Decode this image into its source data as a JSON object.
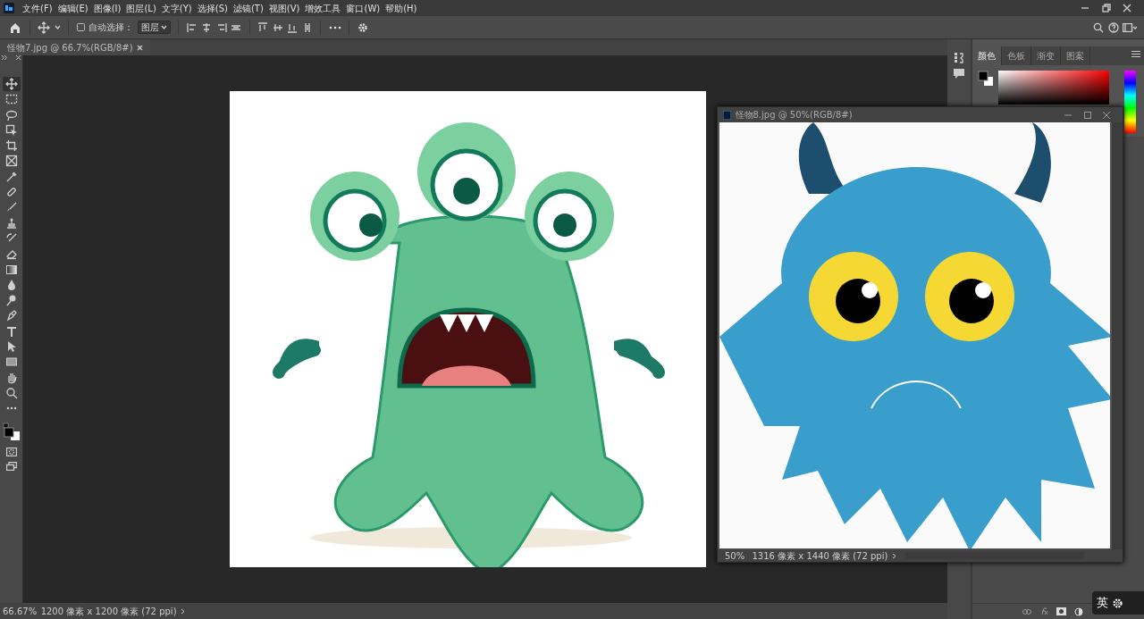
{
  "menu": [
    {
      "label": "文件(F)"
    },
    {
      "label": "编辑(E)"
    },
    {
      "label": "图像(I)"
    },
    {
      "label": "图层(L)"
    },
    {
      "label": "文字(Y)"
    },
    {
      "label": "选择(S)"
    },
    {
      "label": "滤镜(T)"
    },
    {
      "label": "视图(V)"
    },
    {
      "label": "增效工具"
    },
    {
      "label": "窗口(W)"
    },
    {
      "label": "帮助(H)"
    }
  ],
  "options_bar": {
    "auto_select": {
      "label": "自动选择：",
      "checked": false
    },
    "target": {
      "value": "图层"
    }
  },
  "document_tab": {
    "title": "怪物7.jpg @ 66.7%(RGB/8#)"
  },
  "tools": [
    {
      "kind": "move",
      "selected": true
    },
    {
      "kind": "marquee",
      "selected": false
    },
    {
      "kind": "lasso",
      "selected": false
    },
    {
      "kind": "object-select",
      "selected": false
    },
    {
      "kind": "crop",
      "selected": false
    },
    {
      "kind": "frame",
      "selected": false
    },
    {
      "kind": "eyedropper",
      "selected": false
    },
    {
      "kind": "healing",
      "selected": false
    },
    {
      "kind": "brush",
      "selected": false
    },
    {
      "kind": "stamp",
      "selected": false
    },
    {
      "kind": "history-brush",
      "selected": false
    },
    {
      "kind": "eraser",
      "selected": false
    },
    {
      "kind": "gradient",
      "selected": false
    },
    {
      "kind": "blur",
      "selected": false
    },
    {
      "kind": "dodge",
      "selected": false
    },
    {
      "kind": "pen",
      "selected": false
    },
    {
      "kind": "type",
      "selected": false
    },
    {
      "kind": "path-select",
      "selected": false
    },
    {
      "kind": "rectangle",
      "selected": false
    },
    {
      "kind": "hand",
      "selected": false
    },
    {
      "kind": "zoom",
      "selected": false
    },
    {
      "kind": "more",
      "selected": false
    }
  ],
  "status_bar": {
    "zoom": "66.67%",
    "info": "1200 像素 x 1200 像素 (72 ppi)"
  },
  "floating_window": {
    "title": "怪物8.jpg @ 50%(RGB/8#)",
    "zoom": "50%",
    "info": "1316 像素 x 1440 像素 (72 ppi)"
  },
  "color_panel": {
    "tabs": [
      {
        "label": "颜色",
        "selected": true
      },
      {
        "label": "色板",
        "selected": false
      },
      {
        "label": "渐变",
        "selected": false
      },
      {
        "label": "图案",
        "selected": false
      }
    ]
  },
  "ime": {
    "label": "英"
  }
}
